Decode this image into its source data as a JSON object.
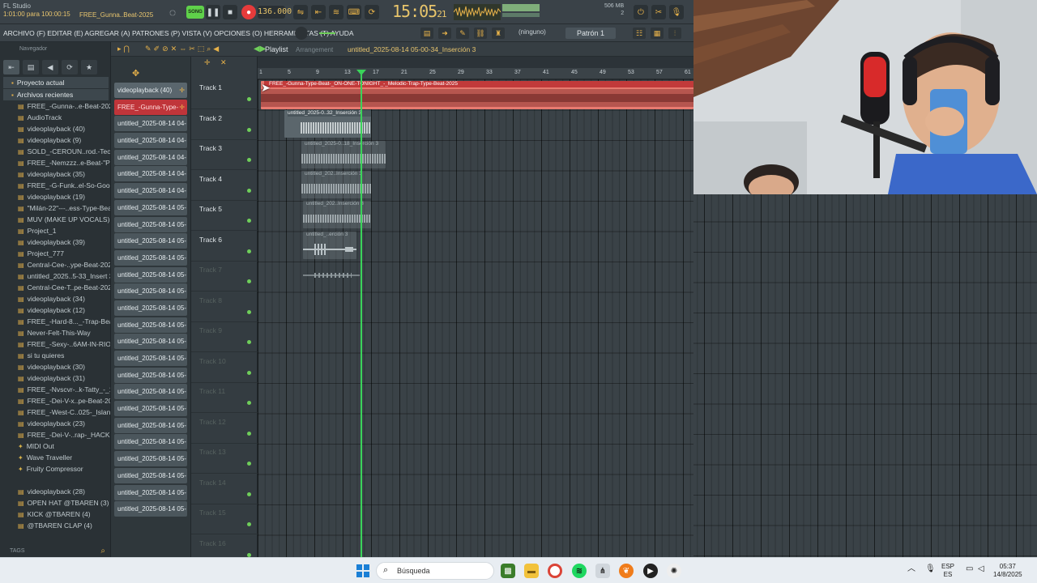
{
  "app": {
    "title": "FL Studio",
    "position_readout": "1:01:00 para 100:00:15",
    "song_name": "FREE_Gunna..Beat-2025",
    "tempo": "136.000",
    "clock_main": "15:05",
    "clock_sub": "21",
    "mem": "506 MB",
    "voices": "2",
    "mode_label": "SONG"
  },
  "menu": {
    "items": "ARCHIVO (F)  EDITAR (E)  AGREGAR (A)  PATRONES (P)  VISTA (V)  OPCIONES (O)  HERRAMIENTAS (T)  AYUDA",
    "selector": "(ninguno)",
    "pattern": "Patrón 1"
  },
  "browser": {
    "title": "Navegador",
    "folder_current": "Proyecto actual",
    "folder_recent": "Archivos recientes",
    "items": [
      {
        "label": "FREE_-Gunna-..e-Beat-2025",
        "type": "file"
      },
      {
        "label": "AudioTrack",
        "type": "file"
      },
      {
        "label": "videoplayback (40)",
        "type": "file"
      },
      {
        "label": "videoplayback (9)",
        "type": "file"
      },
      {
        "label": "SOLD_-CEROUN..rod.-Tecusi",
        "type": "file"
      },
      {
        "label": "FREE_-Nemzzz..e-Beat-\"Pain\"",
        "type": "file"
      },
      {
        "label": "videoplayback (35)",
        "type": "file"
      },
      {
        "label": "FREE_-G-Funk..el-So-Good_",
        "type": "file"
      },
      {
        "label": "videoplayback (19)",
        "type": "file"
      },
      {
        "label": "\"Milán-22\"---..ess-Type-Beat",
        "type": "file"
      },
      {
        "label": "MUV (MAKE UP VOCALS)",
        "type": "file"
      },
      {
        "label": "Project_1",
        "type": "file"
      },
      {
        "label": "videoplayback (39)",
        "type": "file"
      },
      {
        "label": "Project_777",
        "type": "file"
      },
      {
        "label": "Central-Cee-..ype-Beat-2023",
        "type": "file"
      },
      {
        "label": "untitled_2025..5-33_Insert 3",
        "type": "file"
      },
      {
        "label": "Central-Cee-T..pe-Beat-2023",
        "type": "file"
      },
      {
        "label": "videoplayback (34)",
        "type": "file"
      },
      {
        "label": "videoplayback (12)",
        "type": "file"
      },
      {
        "label": "FREE_-Hard-8..._-Trap-Beat",
        "type": "file"
      },
      {
        "label": "Never-Felt-This-Way",
        "type": "file"
      },
      {
        "label": "FREE_-Sexy-..6AM-IN-RIO_",
        "type": "file"
      },
      {
        "label": "si tu quieres",
        "type": "file"
      },
      {
        "label": "videoplayback (30)",
        "type": "file"
      },
      {
        "label": "videoplayback (31)",
        "type": "file"
      },
      {
        "label": "FREE_-Nvscvr-..k-Tatty_-_1",
        "type": "file"
      },
      {
        "label": "FREE_-Dei-V-x..pe-Beat-2025",
        "type": "file"
      },
      {
        "label": "FREE_-West-C..025-_Island_",
        "type": "file"
      },
      {
        "label": "videoplayback (23)",
        "type": "file"
      },
      {
        "label": "FREE_-Dei-V-..rap-_HACKIA_",
        "type": "file"
      },
      {
        "label": "MIDI Out",
        "type": "plug"
      },
      {
        "label": "Wave Traveller",
        "type": "plug"
      },
      {
        "label": "Fruity Compressor",
        "type": "plug"
      },
      {
        "label": "",
        "type": "blank"
      },
      {
        "label": "videoplayback (28)",
        "type": "file"
      },
      {
        "label": "OPEN HAT @TBAREN  (3)",
        "type": "file"
      },
      {
        "label": "KICK @TBAREN (4)",
        "type": "file"
      },
      {
        "label": "@TBAREN CLAP (4)",
        "type": "file"
      }
    ],
    "tags_label": "TAGS"
  },
  "picker": {
    "items": [
      {
        "label": "videoplayback (40)",
        "style": "hl"
      },
      {
        "label": "FREE_-Gunna-Type-",
        "style": "red"
      },
      {
        "label": "untitled_2025-08-14 04-",
        "style": "normal"
      },
      {
        "label": "untitled_2025-08-14 04-",
        "style": "normal"
      },
      {
        "label": "untitled_2025-08-14 04-",
        "style": "normal"
      },
      {
        "label": "untitled_2025-08-14 04-",
        "style": "normal"
      },
      {
        "label": "untitled_2025-08-14 04-",
        "style": "normal"
      },
      {
        "label": "untitled_2025-08-14 05-",
        "style": "normal"
      },
      {
        "label": "untitled_2025-08-14 05-",
        "style": "normal"
      },
      {
        "label": "untitled_2025-08-14 05-",
        "style": "normal"
      },
      {
        "label": "untitled_2025-08-14 05-",
        "style": "normal"
      },
      {
        "label": "untitled_2025-08-14 05-",
        "style": "normal"
      },
      {
        "label": "untitled_2025-08-14 05-",
        "style": "normal"
      },
      {
        "label": "untitled_2025-08-14 05-",
        "style": "normal"
      },
      {
        "label": "untitled_2025-08-14 05-",
        "style": "normal"
      },
      {
        "label": "untitled_2025-08-14 05-",
        "style": "normal"
      },
      {
        "label": "untitled_2025-08-14 05-",
        "style": "normal"
      },
      {
        "label": "untitled_2025-08-14 05-",
        "style": "normal"
      },
      {
        "label": "untitled_2025-08-14 05-",
        "style": "normal"
      },
      {
        "label": "untitled_2025-08-14 05-",
        "style": "normal"
      },
      {
        "label": "untitled_2025-08-14 05-",
        "style": "normal"
      },
      {
        "label": "untitled_2025-08-14 05-",
        "style": "normal"
      },
      {
        "label": "untitled_2025-08-14 05-",
        "style": "normal"
      },
      {
        "label": "untitled_2025-08-14 05-",
        "style": "normal"
      },
      {
        "label": "untitled_2025-08-14 05-",
        "style": "normal"
      },
      {
        "label": "untitled_2025-08-14 05-",
        "style": "normal"
      }
    ]
  },
  "playlist": {
    "title": "Playlist",
    "subtitle": "Arrangement",
    "arrangement_name": "untitled_2025-08-14 05-00-34_Inserción 3",
    "bars": [
      "1",
      "5",
      "9",
      "13",
      "17",
      "21",
      "25",
      "29",
      "33",
      "37",
      "41",
      "45",
      "49",
      "53",
      "57",
      "61"
    ],
    "tracks": [
      "Track 1",
      "Track 2",
      "Track 3",
      "Track 4",
      "Track 5",
      "Track 6",
      "Track 7",
      "Track 8",
      "Track 9",
      "Track 10",
      "Track 11",
      "Track 12",
      "Track 13",
      "Track 14",
      "Track 15",
      "Track 16"
    ],
    "clips": [
      {
        "label": "FREE_-Gunna-Type-Beat-_ON-ONE-TONIGHT_-_Melodic-Trap-Type-Beat-2025"
      },
      {
        "label": "untitled_2025-0..32_Inserción 3"
      },
      {
        "label": "untitled_2025-0..18_Inserción 3"
      },
      {
        "label": "untitled_202..Inserción 3"
      },
      {
        "label": "untitled_202..Inserción 3"
      },
      {
        "label": "untitled_..erción 3"
      }
    ]
  },
  "taskbar": {
    "search_placeholder": "Búsqueda",
    "lang": "ESP",
    "lang_sub": "ES",
    "time": "05:37",
    "date": "14/8/2025"
  },
  "colors": {
    "accent": "#e7b24a",
    "playhead": "#3ad35a",
    "main_clip": "#e87a70"
  }
}
